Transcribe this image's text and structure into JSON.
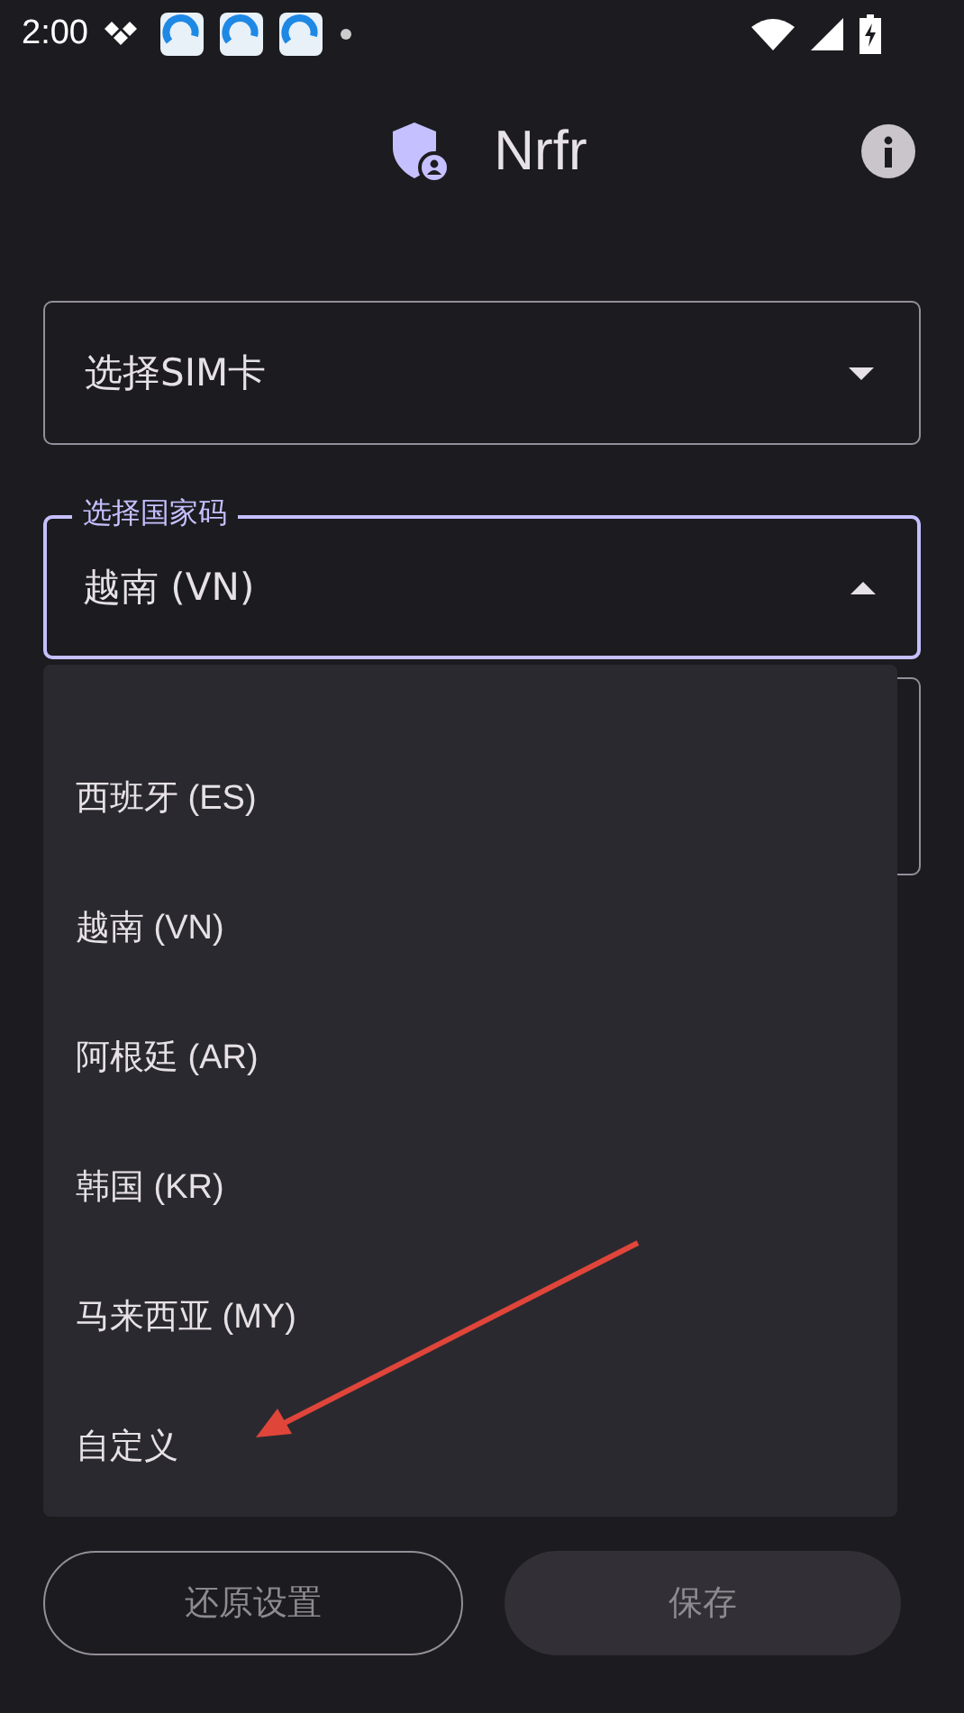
{
  "status_bar": {
    "time": "2:00"
  },
  "app_bar": {
    "title": "Nrfr"
  },
  "sim_field": {
    "value": "选择SIM卡",
    "expanded": false
  },
  "country_field": {
    "label": "选择国家码",
    "value": "越南 (VN)",
    "expanded": true
  },
  "country_menu": {
    "items": [
      {
        "label": "西班牙 (ES)"
      },
      {
        "label": "越南 (VN)"
      },
      {
        "label": "阿根廷 (AR)"
      },
      {
        "label": "韩国 (KR)"
      },
      {
        "label": "马来西亚 (MY)"
      },
      {
        "label": "自定义"
      }
    ]
  },
  "buttons": [
    {
      "label": "还原设置",
      "kind": "outlined"
    },
    {
      "label": "保存",
      "kind": "filled"
    }
  ]
}
